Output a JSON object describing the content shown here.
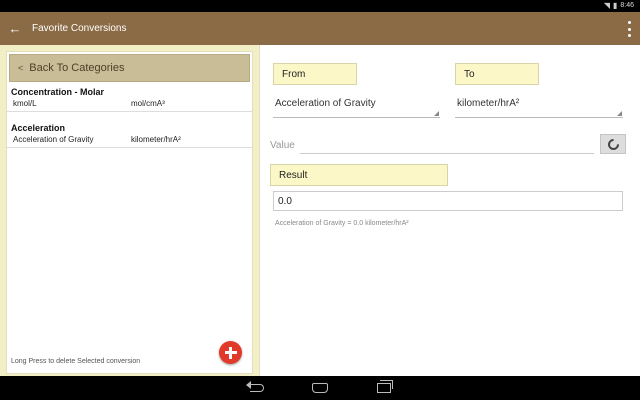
{
  "status_bar": {
    "time": "8:46"
  },
  "action_bar": {
    "title": "Favorite Conversions"
  },
  "left_panel": {
    "back_label": "Back To Categories",
    "conversions": [
      {
        "category": "Concentration - Molar",
        "from": "kmol/L",
        "to": "mol/cmA³"
      },
      {
        "category": "Acceleration",
        "from": "Acceleration of Gravity",
        "to": "kilometer/hrA²"
      }
    ],
    "hint": "Long Press to delete Selected conversion"
  },
  "right_panel": {
    "from_label": "From",
    "to_label": "To",
    "from_unit": "Acceleration of Gravity",
    "to_unit": "kilometer/hrA²",
    "value_placeholder": "Value",
    "result_label": "Result",
    "result_value": "0.0",
    "result_text": "Acceleration of Gravity = 0.0 kilometer/hrA²"
  }
}
